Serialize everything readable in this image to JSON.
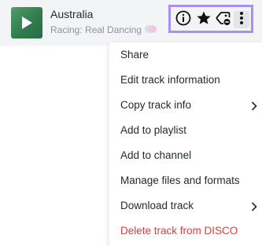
{
  "track": {
    "title": "Australia",
    "subtitle": "Racing: Real Dancing"
  },
  "actions": {
    "info_icon": "info-icon",
    "star_icon": "star-icon",
    "tag_icon": "tag-icon",
    "more_icon": "more-vertical-icon"
  },
  "colors": {
    "highlight": "#a88ff0",
    "danger": "#e0393e",
    "artwork": "#3f8a5a"
  },
  "menu": {
    "items": [
      {
        "label": "Share"
      },
      {
        "label": "Edit track information"
      },
      {
        "label": "Copy track info",
        "submenu": true
      },
      {
        "label": "Add to playlist"
      },
      {
        "label": "Add to channel"
      },
      {
        "label": "Manage files and formats"
      },
      {
        "label": "Download track",
        "submenu": true
      },
      {
        "label": "Delete track from DISCO",
        "danger": true
      }
    ]
  }
}
